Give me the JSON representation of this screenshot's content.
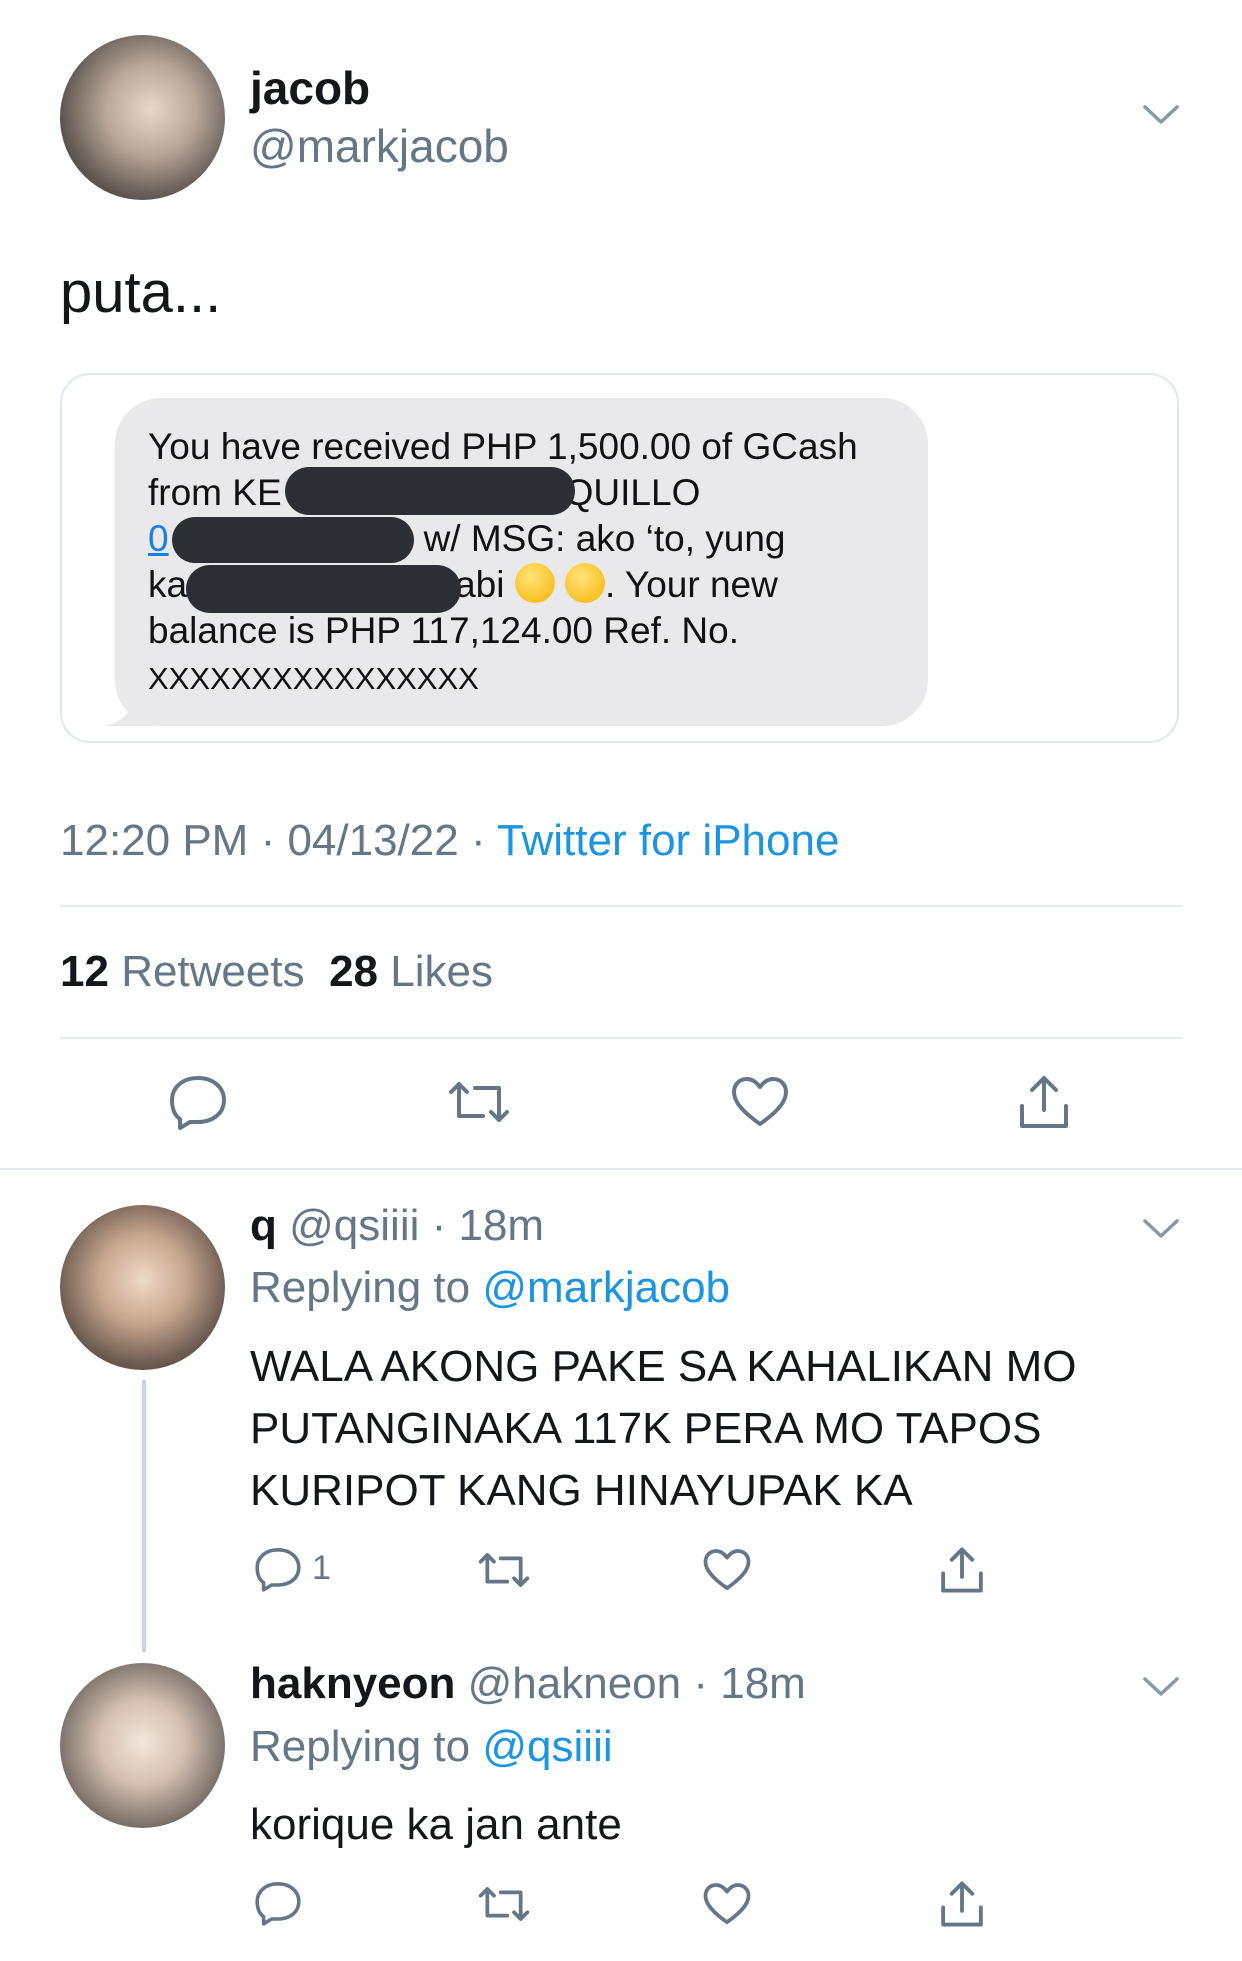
{
  "tweet": {
    "author_name": "jacob",
    "author_handle": "@markjacob",
    "text": "puta...",
    "time": "12:20 PM",
    "date": "04/13/22",
    "separator": " · ",
    "source": "Twitter for iPhone",
    "retweets_count": "12",
    "retweets_label": "Retweets",
    "likes_count": "28",
    "likes_label": "Likes"
  },
  "sms": {
    "line1": "You have received PHP 1,500.00 of GCash",
    "line2_start": "from KE",
    "line2_end": "QUILLO",
    "line3_start": "0",
    "line3_end": "w/ MSG: ako ‘to, yung",
    "line4_start": "ka",
    "line4_end": "abi",
    "line4_tail": ". Your new",
    "line5": "balance is PHP 117,124.00 Ref. No.",
    "line6": "XXXXXXXXXXXXXXXX"
  },
  "replies": [
    {
      "author_name": "q",
      "author_handle": "@qsiiii",
      "time": "18m",
      "replying_label": "Replying to",
      "replying_to": "@markjacob",
      "text_lines": [
        "WALA AKONG PAKE SA KAHALIKAN MO",
        "PUTANGINAKA 117K PERA MO TAPOS",
        "KURIPOT KANG HINAYUPAK KA"
      ],
      "reply_count": "1"
    },
    {
      "author_name": "haknyeon",
      "author_handle": "@hakneon",
      "time": "18m",
      "replying_label": "Replying to",
      "replying_to": "@qsiiii",
      "text_lines": [
        "korique ka jan ante"
      ],
      "reply_count": ""
    }
  ],
  "icons": {
    "chevron": "chevron-down-icon",
    "reply": "reply-icon",
    "retweet": "retweet-icon",
    "like": "heart-icon",
    "share": "share-icon"
  },
  "colors": {
    "link_blue": "#1b95e0",
    "secondary_gray": "#657786",
    "divider": "#e6ecf0",
    "bubble": "#e9e9eb",
    "redaction": "#2b2f33"
  }
}
